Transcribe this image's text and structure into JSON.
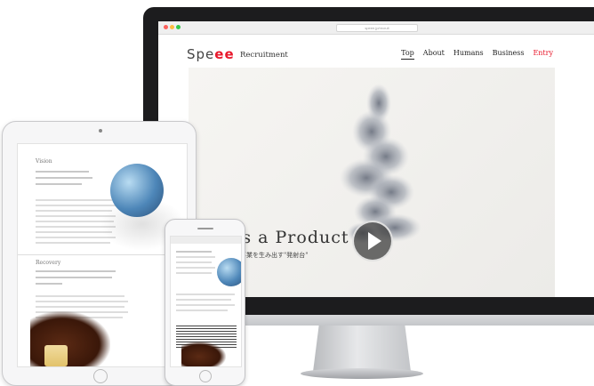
{
  "desktop": {
    "browser": {
      "url": "speee.jp/recruit"
    },
    "logo": {
      "text_main": "Spe",
      "text_accent": "ee"
    },
    "subtitle": "Recruitment",
    "nav": [
      {
        "label": "Top"
      },
      {
        "label": "About"
      },
      {
        "label": "Humans"
      },
      {
        "label": "Business"
      },
      {
        "label": "Entry"
      }
    ],
    "hero": {
      "title": "e is a Product",
      "subtitle": "事業を生み出す\"発射台\""
    }
  },
  "tablet": {
    "section1_label": "Vision",
    "section2_label": "Recovery"
  },
  "colors": {
    "accent": "#e8192c",
    "bezel": "#1c1c1e"
  }
}
